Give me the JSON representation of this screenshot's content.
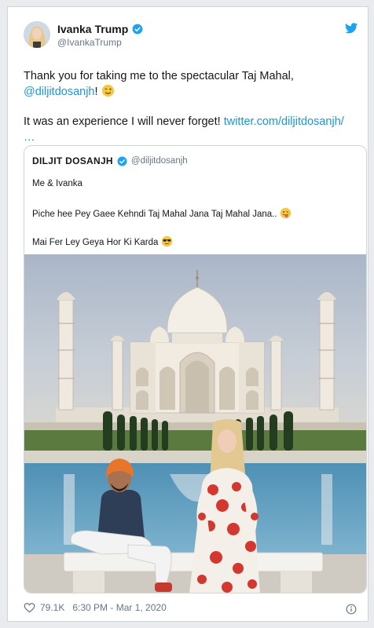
{
  "tweet": {
    "author_name": "Ivanka Trump",
    "author_handle": "@IvankaTrump",
    "text_line1": "Thank you for taking me to the spectacular Taj Mahal,",
    "mention": "@diljitdosanjh",
    "mention_suffix": "!",
    "text_line2": "It was an experience I will never forget!",
    "link": "twitter.com/diljitdosanjh/",
    "link_ellipsis": "…",
    "likes": "79.1K",
    "timestamp": "6:30 PM - Mar 1, 2020",
    "icons": [
      "verified-icon",
      "twitter-bird-icon",
      "heart-icon",
      "info-icon",
      "winking-face-icon"
    ]
  },
  "quoted_tweet": {
    "author_name": "DILJIT DOSANJH",
    "author_handle": "@diljitdosanjh",
    "line1": "Me & Ivanka",
    "line2": "Piche hee Pey Gaee Kehndi Taj Mahal Jana Taj Mahal Jana..",
    "line3": "Mai Fer Ley Geya Hor Ki Karda",
    "icons": [
      "verified-icon",
      "tongue-face-icon",
      "sunglasses-face-icon"
    ]
  },
  "colors": {
    "link": "#1b95e0",
    "text": "#14171a",
    "muted": "#657786",
    "verified": "#1da1f2"
  }
}
